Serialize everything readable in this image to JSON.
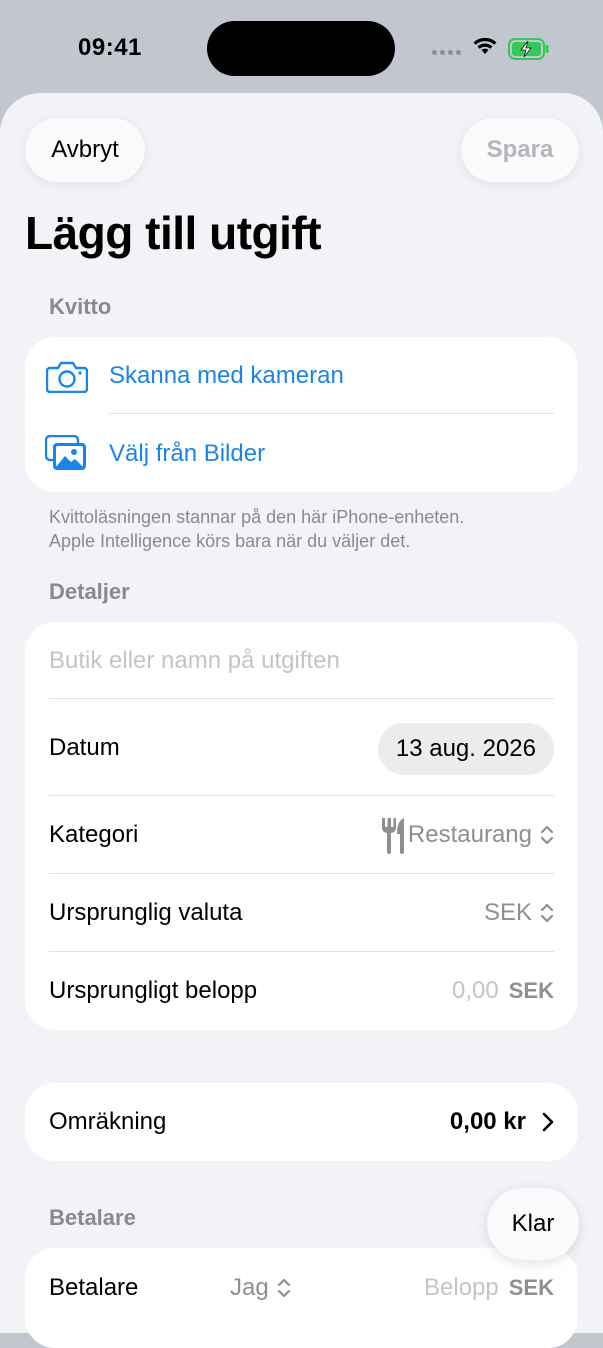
{
  "status": {
    "time": "09:41"
  },
  "nav": {
    "cancel_label": "Avbryt",
    "save_label": "Spara"
  },
  "title": "Lägg till utgift",
  "receipt": {
    "header": "Kvitto",
    "scan_label": "Skanna med kameran",
    "photos_label": "Välj från Bilder",
    "footnote_line1": "Kvittoläsningen stannar på den här iPhone-enheten.",
    "footnote_line2": "Apple Intelligence körs bara när du väljer det."
  },
  "details": {
    "header": "Detaljer",
    "name_placeholder": "Butik eller namn på utgiften",
    "date_label": "Datum",
    "date_value": "13 aug. 2026",
    "category_label": "Kategori",
    "category_value": "Restaurang",
    "currency_label": "Ursprunglig valuta",
    "currency_value": "SEK",
    "amount_label": "Ursprungligt belopp",
    "amount_placeholder": "0,00",
    "amount_currency": "SEK"
  },
  "conversion": {
    "label": "Omräkning",
    "value": "0,00 kr"
  },
  "payer": {
    "header": "Betalare",
    "label": "Betalare",
    "selected": "Jag",
    "amount_placeholder": "Belopp",
    "currency": "SEK"
  },
  "keyboard_done": "Klar",
  "colors": {
    "accent": "#1a84e8",
    "background": "#f2f2f7",
    "card": "#ffffff"
  }
}
